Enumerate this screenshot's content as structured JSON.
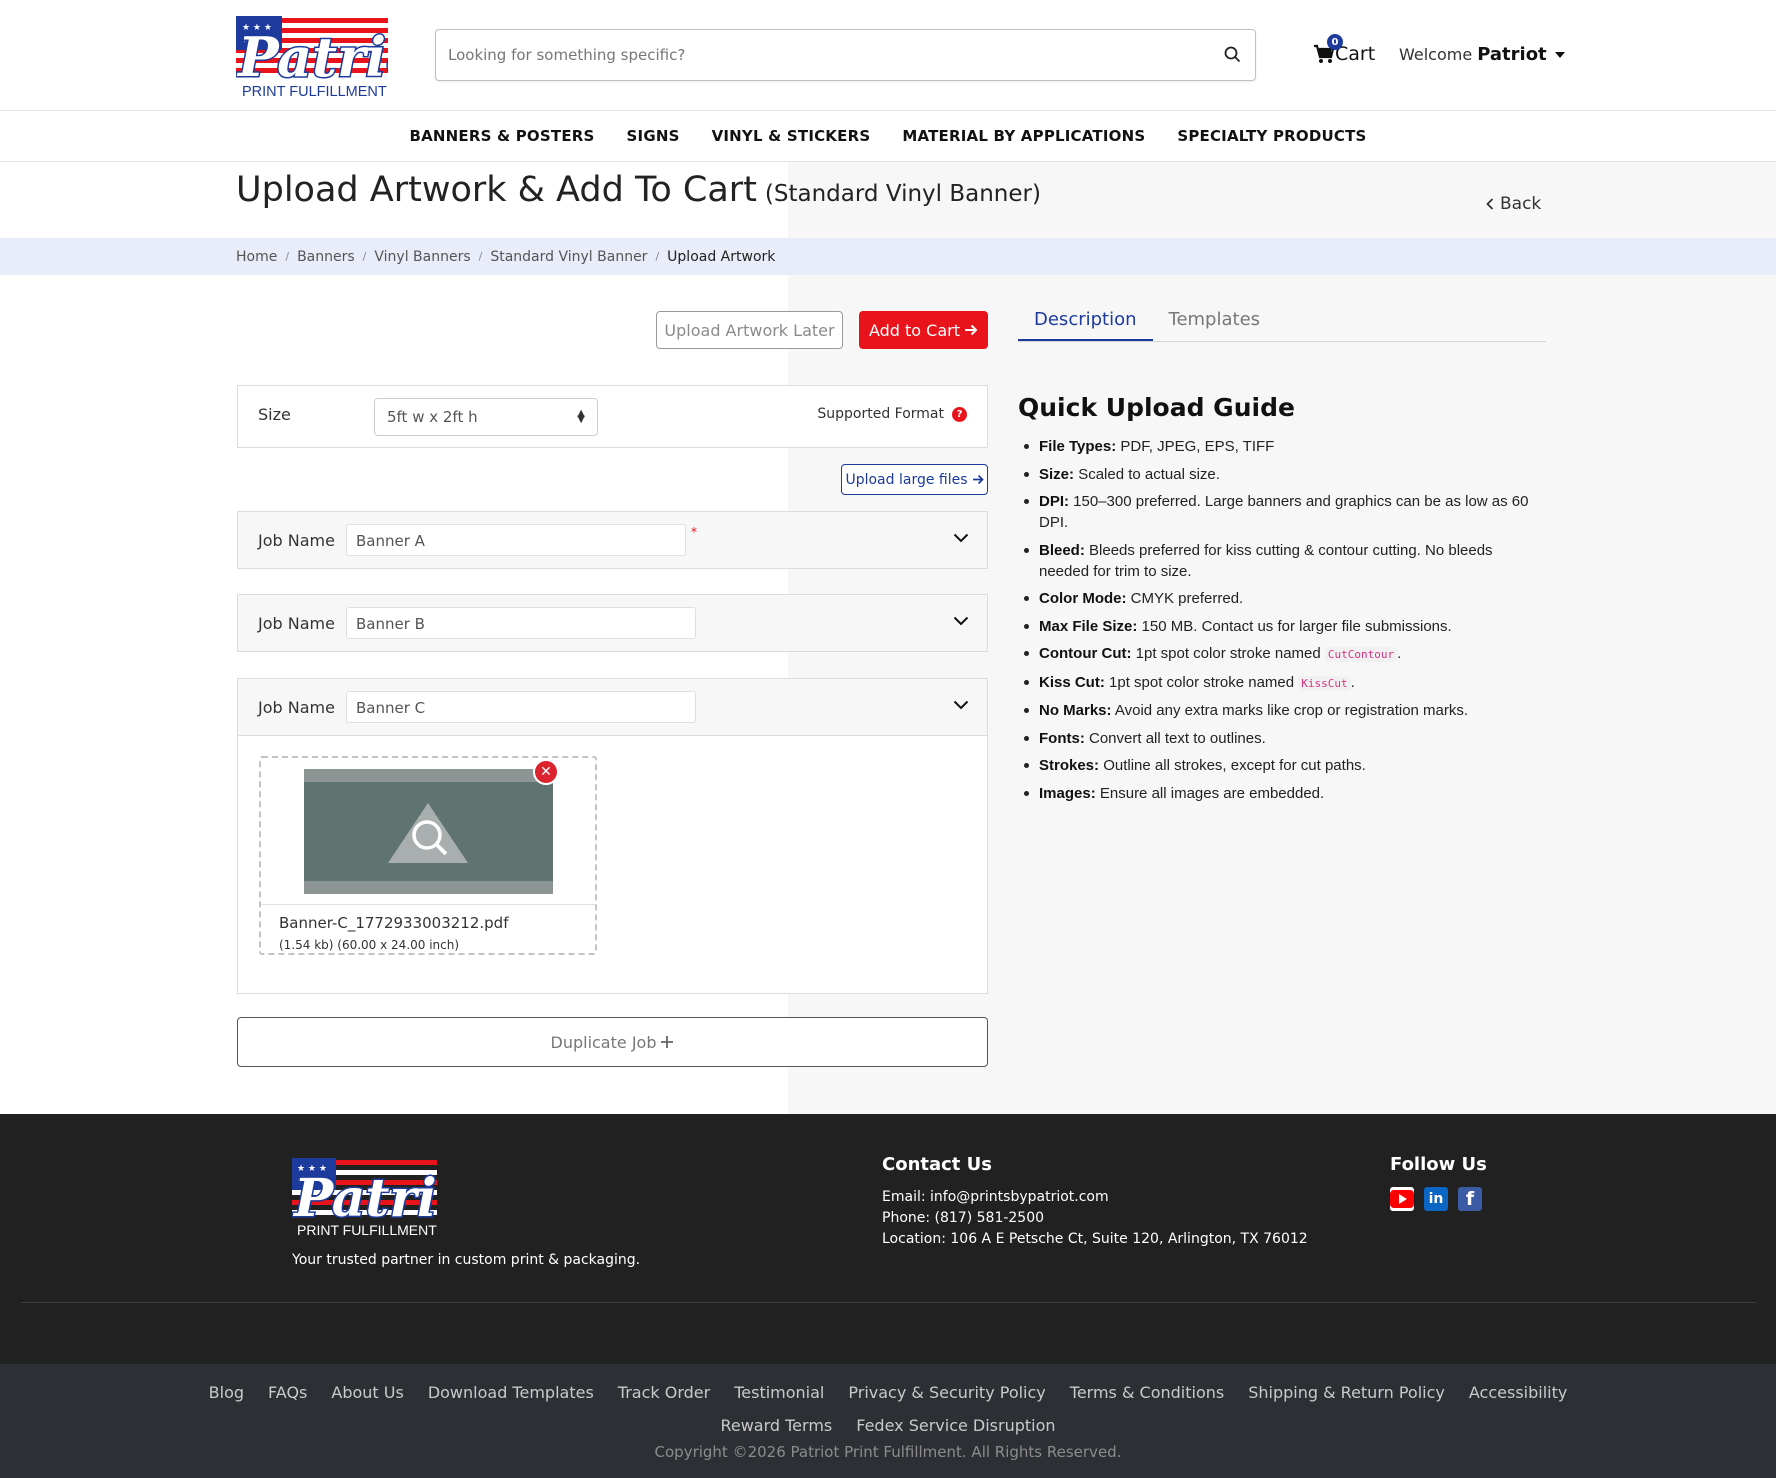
{
  "header": {
    "logo_text": "Patriot",
    "logo_sub": "PRINT FULFILLMENT",
    "search_placeholder": "Looking for something specific?",
    "cart_label": "Cart",
    "cart_count": "0",
    "welcome_label": "Welcome",
    "user_name": "Patriot"
  },
  "nav": [
    "BANNERS & POSTERS",
    "SIGNS",
    "VINYL & STICKERS",
    "MATERIAL BY APPLICATIONS",
    "SPECIALTY PRODUCTS"
  ],
  "page": {
    "title": "Upload Artwork & Add To Cart",
    "subtitle": "(Standard Vinyl Banner)",
    "back_label": "Back"
  },
  "breadcrumb": [
    "Home",
    "Banners",
    "Vinyl Banners",
    "Standard Vinyl Banner",
    "Upload Artwork"
  ],
  "actions": {
    "upload_later": "Upload Artwork Later",
    "add_to_cart": "Add to Cart"
  },
  "size": {
    "label": "Size",
    "selected": "5ft w x 2ft h",
    "supported_format": "Supported Format",
    "help_glyph": "?"
  },
  "upload_large": "Upload large files",
  "jobs": [
    {
      "label": "Job Name",
      "value": "Banner A",
      "required_mark": "*"
    },
    {
      "label": "Job Name",
      "value": "Banner B"
    },
    {
      "label": "Job Name",
      "value": "Banner C"
    }
  ],
  "file": {
    "name": "Banner-C_1772933003212.pdf",
    "meta": "(1.54 kb) (60.00 x 24.00 inch)"
  },
  "duplicate_label": "Duplicate Job",
  "tabs": [
    {
      "label": "Description",
      "active": true
    },
    {
      "label": "Templates",
      "active": false
    }
  ],
  "guide": {
    "title": "Quick Upload Guide",
    "items": [
      {
        "key": "File Types:",
        "text": "PDF, JPEG, EPS, TIFF"
      },
      {
        "key": "Size:",
        "text": "Scaled to actual size."
      },
      {
        "key": "DPI:",
        "text": "150–300 preferred. Large banners and graphics can be as low as 60 DPI."
      },
      {
        "key": "Bleed:",
        "text": "Bleeds preferred for kiss cutting & contour cutting. No bleeds needed for trim to size."
      },
      {
        "key": "Color Mode:",
        "text": "CMYK preferred."
      },
      {
        "key": "Max File Size:",
        "text": "150 MB. Contact us for larger file submissions."
      },
      {
        "key": "Contour Cut:",
        "text": "1pt spot color stroke named",
        "code": "CutContour",
        "after": "."
      },
      {
        "key": "Kiss Cut:",
        "text": "1pt spot color stroke named",
        "code": "KissCut",
        "after": "."
      },
      {
        "key": "No Marks:",
        "text": "Avoid any extra marks like crop or registration marks."
      },
      {
        "key": "Fonts:",
        "text": "Convert all text to outlines."
      },
      {
        "key": "Strokes:",
        "text": "Outline all strokes, except for cut paths."
      },
      {
        "key": "Images:",
        "text": "Ensure all images are embedded."
      }
    ]
  },
  "footer": {
    "tagline": "Your trusted partner in custom print & packaging.",
    "contact_title": "Contact Us",
    "email": "Email: info@printsbypatriot.com",
    "phone": "Phone: (817) 581-2500",
    "location": "Location: 106 A E Petsche Ct, Suite 120, Arlington, TX 76012",
    "follow_title": "Follow Us",
    "links_row1": [
      "Blog",
      "FAQs",
      "About Us",
      "Download Templates",
      "Track Order",
      "Testimonial",
      "Privacy & Security Policy",
      "Terms & Conditions",
      "Shipping & Return Policy",
      "Accessibility"
    ],
    "links_row2": [
      "Reward Terms",
      "Fedex Service Disruption"
    ],
    "copyright": "Copyright ©2026 Patriot Print Fulfillment. All Rights Reserved."
  },
  "colors": {
    "brand_red": "#e8131b",
    "brand_blue": "#1c3b9c",
    "footer_bg": "#212121",
    "bottom_bg": "#2c3035"
  }
}
